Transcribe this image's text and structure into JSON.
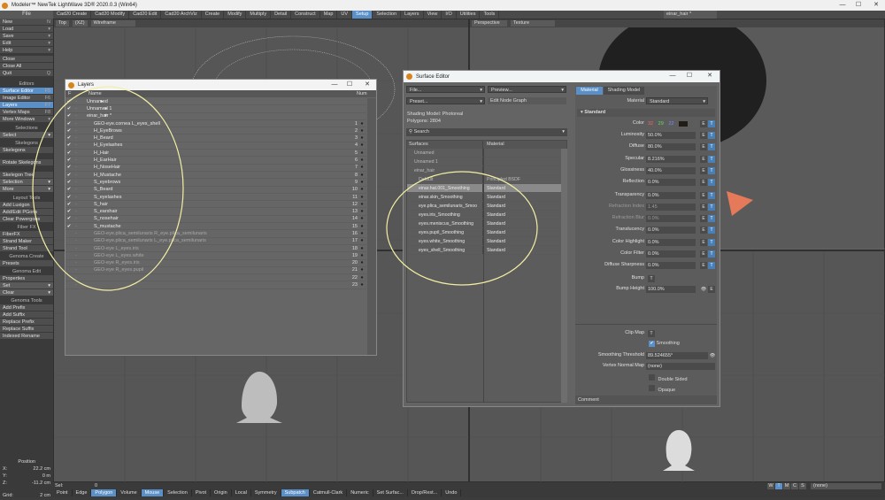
{
  "app": {
    "title": "Modeler™ NewTek LightWave 3D® 2020.0.3 (Win64)"
  },
  "menu": {
    "header": "File"
  },
  "tabs": [
    "Cad20 Create",
    "Cad20 Modify",
    "Cad20 Edit",
    "Cad20 ArchViz",
    "Create",
    "Modify",
    "Multiply",
    "Detail",
    "Construct",
    "Map",
    "UV",
    "Setup",
    "Selection",
    "Layers",
    "View",
    "I/O",
    "Utilities",
    "Tools"
  ],
  "sidebar": {
    "file": [
      {
        "label": "New",
        "sc": "N"
      },
      {
        "label": "Load",
        "sc": "▾"
      },
      {
        "label": "Save",
        "sc": "▾"
      },
      {
        "label": "Edit",
        "sc": "▾"
      },
      {
        "label": "Help",
        "sc": "▾"
      }
    ],
    "file2": [
      {
        "label": "Close",
        "sc": ""
      },
      {
        "label": "Close All",
        "sc": ""
      },
      {
        "label": "Quit",
        "sc": "Q"
      }
    ],
    "editors_hdr": "Editors",
    "editors": [
      {
        "label": "Surface Editor",
        "sc": "F5"
      },
      {
        "label": "Image Editor",
        "sc": "F6"
      },
      {
        "label": "Layers",
        "sc": "F7"
      },
      {
        "label": "Vertex Maps",
        "sc": "F8"
      },
      {
        "label": "More Windows",
        "sc": "▾"
      }
    ],
    "selections_hdr": "Selections",
    "select": "Select",
    "skelegons_hdr": "Skelegons",
    "skelegons": "Skelegons",
    "rotate": "Rotate Skelegons",
    "skeltree": "Skelegon Tree",
    "selection": "Selection",
    "more": "More",
    "layout_hdr": "Layout Tools",
    "layout": [
      "Add Luxigon",
      "Add/Edit PGons",
      "Clear Powergons"
    ],
    "fiber_hdr": "Fiber FX",
    "fiber": [
      "FiberFX",
      "Strand Maker",
      "Strand Tool"
    ],
    "gcreate_hdr": "Genoma Create",
    "presets": "Presets",
    "gedit_hdr": "Genoma Edit",
    "properties": "Properties",
    "set": "Set",
    "clear": "Clear",
    "gtools_hdr": "Genoma Tools",
    "gtools": [
      "Add Prefix",
      "Add Suffix",
      "Replace Prefix",
      "Replace Suffix",
      "Indexed Rename"
    ],
    "position_hdr": "Position",
    "pos": [
      {
        "axis": "X:",
        "val": "22.2 cm"
      },
      {
        "axis": "Y:",
        "val": "0 m"
      },
      {
        "axis": "Z:",
        "val": "-11.2 cm"
      }
    ],
    "grid": {
      "label": "Grid:",
      "val": "2 cm"
    }
  },
  "viewports": {
    "top": {
      "name": "Top",
      "axis": "(XZ)",
      "mode": "Wireframe"
    },
    "persp": {
      "name": "Perspective",
      "mode": "Texture",
      "layer": "einar_hair *"
    }
  },
  "layers": {
    "title": "Layers",
    "col_name": "Name",
    "col_num": "Num",
    "rows": [
      {
        "c": "✔",
        "n": "Unnamed",
        "num": "",
        "d": 0,
        "dim": false
      },
      {
        "c": "✔",
        "n": "Unnamed 1",
        "num": "",
        "d": 0,
        "dim": false
      },
      {
        "c": "✔",
        "n": "einar_hair *",
        "num": "",
        "d": 0,
        "dim": false
      },
      {
        "c": "✔",
        "n": "GEO-eye.cornea L_eyes_shell",
        "num": "1",
        "d": 1,
        "dim": false
      },
      {
        "c": "✔",
        "n": "H_EyeBrows",
        "num": "2",
        "d": 1,
        "dim": false
      },
      {
        "c": "✔",
        "n": "H_Beard",
        "num": "3",
        "d": 1,
        "dim": false
      },
      {
        "c": "✔",
        "n": "H_Eyelashes",
        "num": "4",
        "d": 1,
        "dim": false
      },
      {
        "c": "✔",
        "n": "H_Hair",
        "num": "5",
        "d": 1,
        "dim": false
      },
      {
        "c": "✔",
        "n": "H_EarHair",
        "num": "6",
        "d": 1,
        "dim": false
      },
      {
        "c": "✔",
        "n": "H_NoseHair",
        "num": "7",
        "d": 1,
        "dim": false
      },
      {
        "c": "✔",
        "n": "H_Mustache",
        "num": "8",
        "d": 1,
        "dim": false
      },
      {
        "c": "✔",
        "n": "S_eyebrows",
        "num": "9",
        "d": 1,
        "dim": false
      },
      {
        "c": "✔",
        "n": "S_Beard",
        "num": "10",
        "d": 1,
        "dim": false
      },
      {
        "c": "✔",
        "n": "S_eyelashes",
        "num": "11",
        "d": 1,
        "dim": false
      },
      {
        "c": "✔",
        "n": "S_hair",
        "num": "12",
        "d": 1,
        "dim": false
      },
      {
        "c": "✔",
        "n": "S_earshair",
        "num": "13",
        "d": 1,
        "dim": false
      },
      {
        "c": "✔",
        "n": "S_nosehair",
        "num": "14",
        "d": 1,
        "dim": false
      },
      {
        "c": "✔",
        "n": "S_mustache",
        "num": "15",
        "d": 1,
        "dim": false
      },
      {
        "c": "",
        "n": "GEO-eye.plica_semilunaris R_eye.plica_semilunaris",
        "num": "16",
        "d": 1,
        "dim": true
      },
      {
        "c": "",
        "n": "GEO-eye.plica_semilunaris L_eye.plica_semilunaris",
        "num": "17",
        "d": 1,
        "dim": true
      },
      {
        "c": "",
        "n": "GEO-eye L_eyes.iris",
        "num": "18",
        "d": 1,
        "dim": true
      },
      {
        "c": "",
        "n": "GEO-eye L_eyes.white",
        "num": "19",
        "d": 1,
        "dim": true
      },
      {
        "c": "",
        "n": "GEO-eye R_eyes.iris",
        "num": "20",
        "d": 1,
        "dim": true
      },
      {
        "c": "",
        "n": "GEO-eye R_eyes.pupil",
        "num": "21",
        "d": 1,
        "dim": true
      },
      {
        "c": "",
        "n": "",
        "num": "22",
        "d": 1,
        "dim": true
      },
      {
        "c": "",
        "n": "",
        "num": "23",
        "d": 1,
        "dim": true
      }
    ]
  },
  "surface_editor": {
    "title": "Surface Editor",
    "file": "File...",
    "preview": "Preview...",
    "preset": "Preset...",
    "node_graph": "Edit Node Graph",
    "shading_model_label": "Shading Model:",
    "shading_model": "Photoreal",
    "polygons_label": "Polygons:",
    "polygons": "2804",
    "search": "Search",
    "col_surfaces": "Surfaces",
    "col_material": "Material",
    "surfaces": [
      {
        "n": "Unnamed",
        "m": "",
        "dim": true,
        "sel": false,
        "ind": 0
      },
      {
        "n": "Unnamed 1",
        "m": "",
        "dim": true,
        "sel": false,
        "ind": 0
      },
      {
        "n": "einar_hair",
        "m": "",
        "dim": true,
        "sel": false,
        "ind": 0
      },
      {
        "n": "Default",
        "m": "Principled BSDF",
        "dim": true,
        "sel": false,
        "ind": 1
      },
      {
        "n": "einar.hat.001_Smoothing",
        "m": "Standard",
        "dim": false,
        "sel": true,
        "ind": 1
      },
      {
        "n": "einar.skin_Smoothing",
        "m": "Standard",
        "dim": false,
        "sel": false,
        "ind": 1
      },
      {
        "n": "eye.plica_semilunaris_Smoo",
        "m": "Standard",
        "dim": false,
        "sel": false,
        "ind": 1
      },
      {
        "n": "eyes.iris_Smoothing",
        "m": "Standard",
        "dim": false,
        "sel": false,
        "ind": 1
      },
      {
        "n": "eyes.meniscus_Smoothing",
        "m": "Standard",
        "dim": false,
        "sel": false,
        "ind": 1
      },
      {
        "n": "eyes.pupil_Smoothing",
        "m": "Standard",
        "dim": false,
        "sel": false,
        "ind": 1
      },
      {
        "n": "eyes.white_Smoothing",
        "m": "Standard",
        "dim": false,
        "sel": false,
        "ind": 1
      },
      {
        "n": "eyes_shell_Smoothing",
        "m": "Standard",
        "dim": false,
        "sel": false,
        "ind": 1
      }
    ],
    "tab_material": "Material",
    "tab_shading": "Shading Model",
    "material_label": "Material",
    "material": "Standard",
    "standard_hdr": "Standard",
    "color_label": "Color",
    "color": {
      "r": "32",
      "g": "29",
      "b": "22"
    },
    "props": [
      {
        "l": "Luminosity",
        "v": "50.0%",
        "dim": false
      },
      {
        "l": "Diffuse",
        "v": "80.0%",
        "dim": false
      },
      {
        "l": "Specular",
        "v": "8.216%",
        "dim": false
      },
      {
        "l": "Glossiness",
        "v": "40.0%",
        "dim": false
      },
      {
        "l": "Reflection",
        "v": "0.0%",
        "dim": false
      },
      {
        "l": "Transparency",
        "v": "0.0%",
        "dim": false
      },
      {
        "l": "Refraction Index",
        "v": "1.45",
        "dim": true
      },
      {
        "l": "Refraction Blur",
        "v": "0.0%",
        "dim": true
      },
      {
        "l": "Translucency",
        "v": "0.0%",
        "dim": false
      },
      {
        "l": "Color Highlight",
        "v": "0.0%",
        "dim": false
      },
      {
        "l": "Color Filter",
        "v": "0.0%",
        "dim": false
      },
      {
        "l": "Diffuse Sharpness",
        "v": "0.0%",
        "dim": false
      }
    ],
    "bump": "Bump",
    "bump_height_label": "Bump Height",
    "bump_height": "100.0%",
    "clip_map": "Clip Map",
    "smoothing": "Smoothing",
    "smoothing_threshold_label": "Smoothing Threshold",
    "smoothing_threshold": "89.524655°",
    "vertex_normal_label": "Vertex Normal Map",
    "vertex_normal": "(none)",
    "double_sided": "Double Sided",
    "opaque": "Opaque",
    "comment": "Comment"
  },
  "status": {
    "sel_label": "Sel:",
    "sel_val": "0",
    "row1": [
      "Point",
      "Edge",
      "Polygon",
      "Volume",
      "Mouse",
      "Selection",
      "Pivot",
      "Origin",
      "Local",
      "Symmetry",
      "Subpatch",
      "Catmull-Clark",
      "Numeric",
      "Set Surfac...",
      "Drop/Rest...",
      "Undo"
    ],
    "right": [
      "W",
      "T",
      "M",
      "C",
      "S"
    ],
    "right_dd": "(none)"
  },
  "colors": {
    "accent": "#5b8fc7",
    "annotation": "#f3efa4"
  }
}
